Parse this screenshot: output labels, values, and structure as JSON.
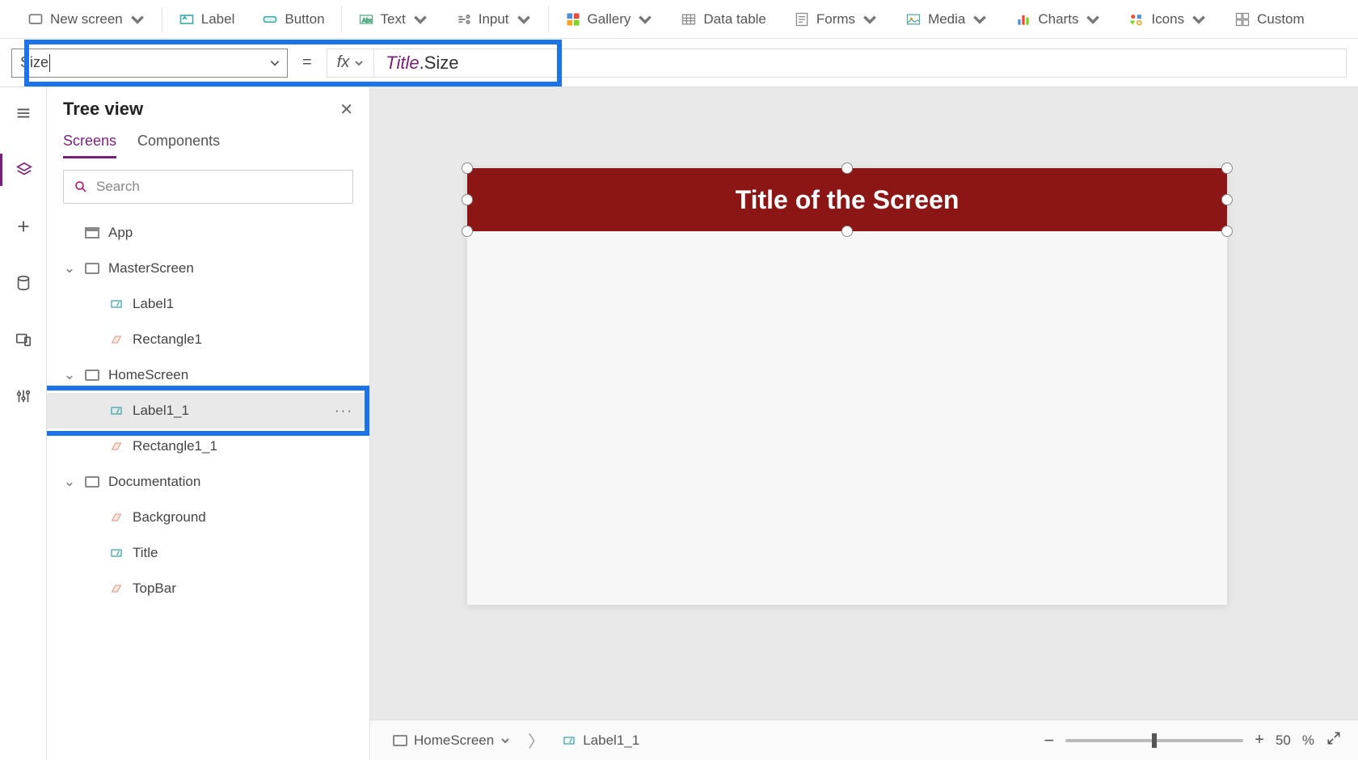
{
  "ribbon": {
    "new_screen": "New screen",
    "label": "Label",
    "button": "Button",
    "text": "Text",
    "input": "Input",
    "gallery": "Gallery",
    "data_table": "Data table",
    "forms": "Forms",
    "media": "Media",
    "charts": "Charts",
    "icons": "Icons",
    "custom": "Custom"
  },
  "formula": {
    "property": "Size",
    "fx": "fx",
    "equals": "=",
    "expr_obj": "Title",
    "expr_dot": ".",
    "expr_prop": "Size"
  },
  "tree": {
    "title": "Tree view",
    "tabs": {
      "screens": "Screens",
      "components": "Components"
    },
    "search_placeholder": "Search",
    "nodes": {
      "app": "App",
      "master": "MasterScreen",
      "master_label1": "Label1",
      "master_rect1": "Rectangle1",
      "home": "HomeScreen",
      "home_label11": "Label1_1",
      "home_rect11": "Rectangle1_1",
      "doc": "Documentation",
      "doc_bg": "Background",
      "doc_title": "Title",
      "doc_topbar": "TopBar"
    },
    "more": "···"
  },
  "canvas": {
    "title_text": "Title of the Screen"
  },
  "status": {
    "screen": "HomeScreen",
    "selected": "Label1_1",
    "zoom": "50",
    "zoom_pct": "%",
    "minus": "−",
    "plus": "+"
  }
}
